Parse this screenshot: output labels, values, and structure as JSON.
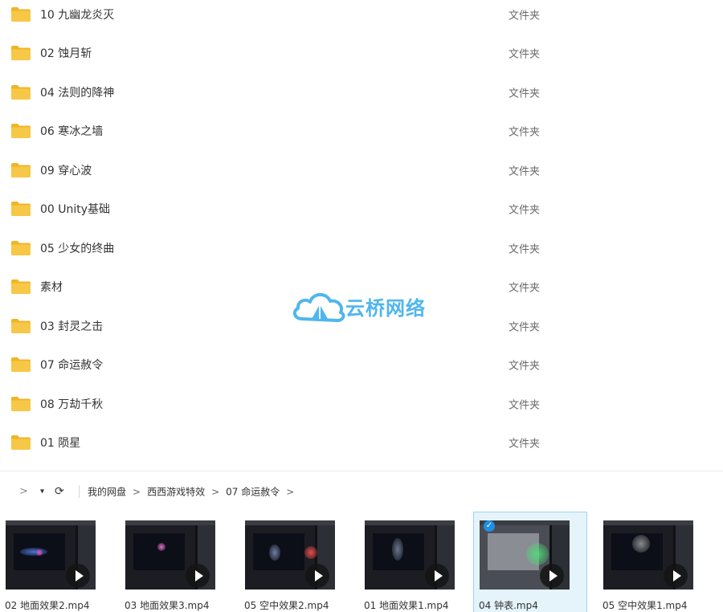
{
  "file_list": {
    "rows": [
      {
        "name": "10 九幽龙炎灭",
        "type": "文件夹"
      },
      {
        "name": "02 蚀月斩",
        "type": "文件夹"
      },
      {
        "name": "04 法则的降神",
        "type": "文件夹"
      },
      {
        "name": "06 寒冰之墙",
        "type": "文件夹"
      },
      {
        "name": "09 穿心波",
        "type": "文件夹"
      },
      {
        "name": "00 Unity基础",
        "type": "文件夹"
      },
      {
        "name": "05 少女的终曲",
        "type": "文件夹"
      },
      {
        "name": "素材",
        "type": "文件夹"
      },
      {
        "name": "03 封灵之击",
        "type": "文件夹"
      },
      {
        "name": "07 命运赦令",
        "type": "文件夹"
      },
      {
        "name": "08 万劫千秋",
        "type": "文件夹"
      },
      {
        "name": "01 陨星",
        "type": "文件夹"
      }
    ]
  },
  "watermark": {
    "text": "云桥网络"
  },
  "nav": {
    "forward_icon": ">",
    "dropdown_icon": "▾",
    "refresh_icon": "⟳",
    "breadcrumb": [
      "我的网盘",
      "西西游戏特效",
      "07 命运赦令"
    ],
    "separator": ">"
  },
  "thumbnails": [
    {
      "label": "02 地面效果2.mp4",
      "selected": false
    },
    {
      "label": "03 地面效果3.mp4",
      "selected": false
    },
    {
      "label": "05 空中效果2.mp4",
      "selected": false
    },
    {
      "label": "01 地面效果1.mp4",
      "selected": false
    },
    {
      "label": "04 钟表.mp4",
      "selected": true
    },
    {
      "label": "05 空中效果1.mp4",
      "selected": false
    }
  ],
  "colors": {
    "folder": "#f7c847",
    "folder_dark": "#f0b429",
    "selected_bg": "#e5f3fb",
    "watermark": "#4fb6ee",
    "check": "#1e8fe1"
  },
  "icons": {
    "folder": "folder-icon",
    "play": "play-icon",
    "check": "check-icon"
  }
}
